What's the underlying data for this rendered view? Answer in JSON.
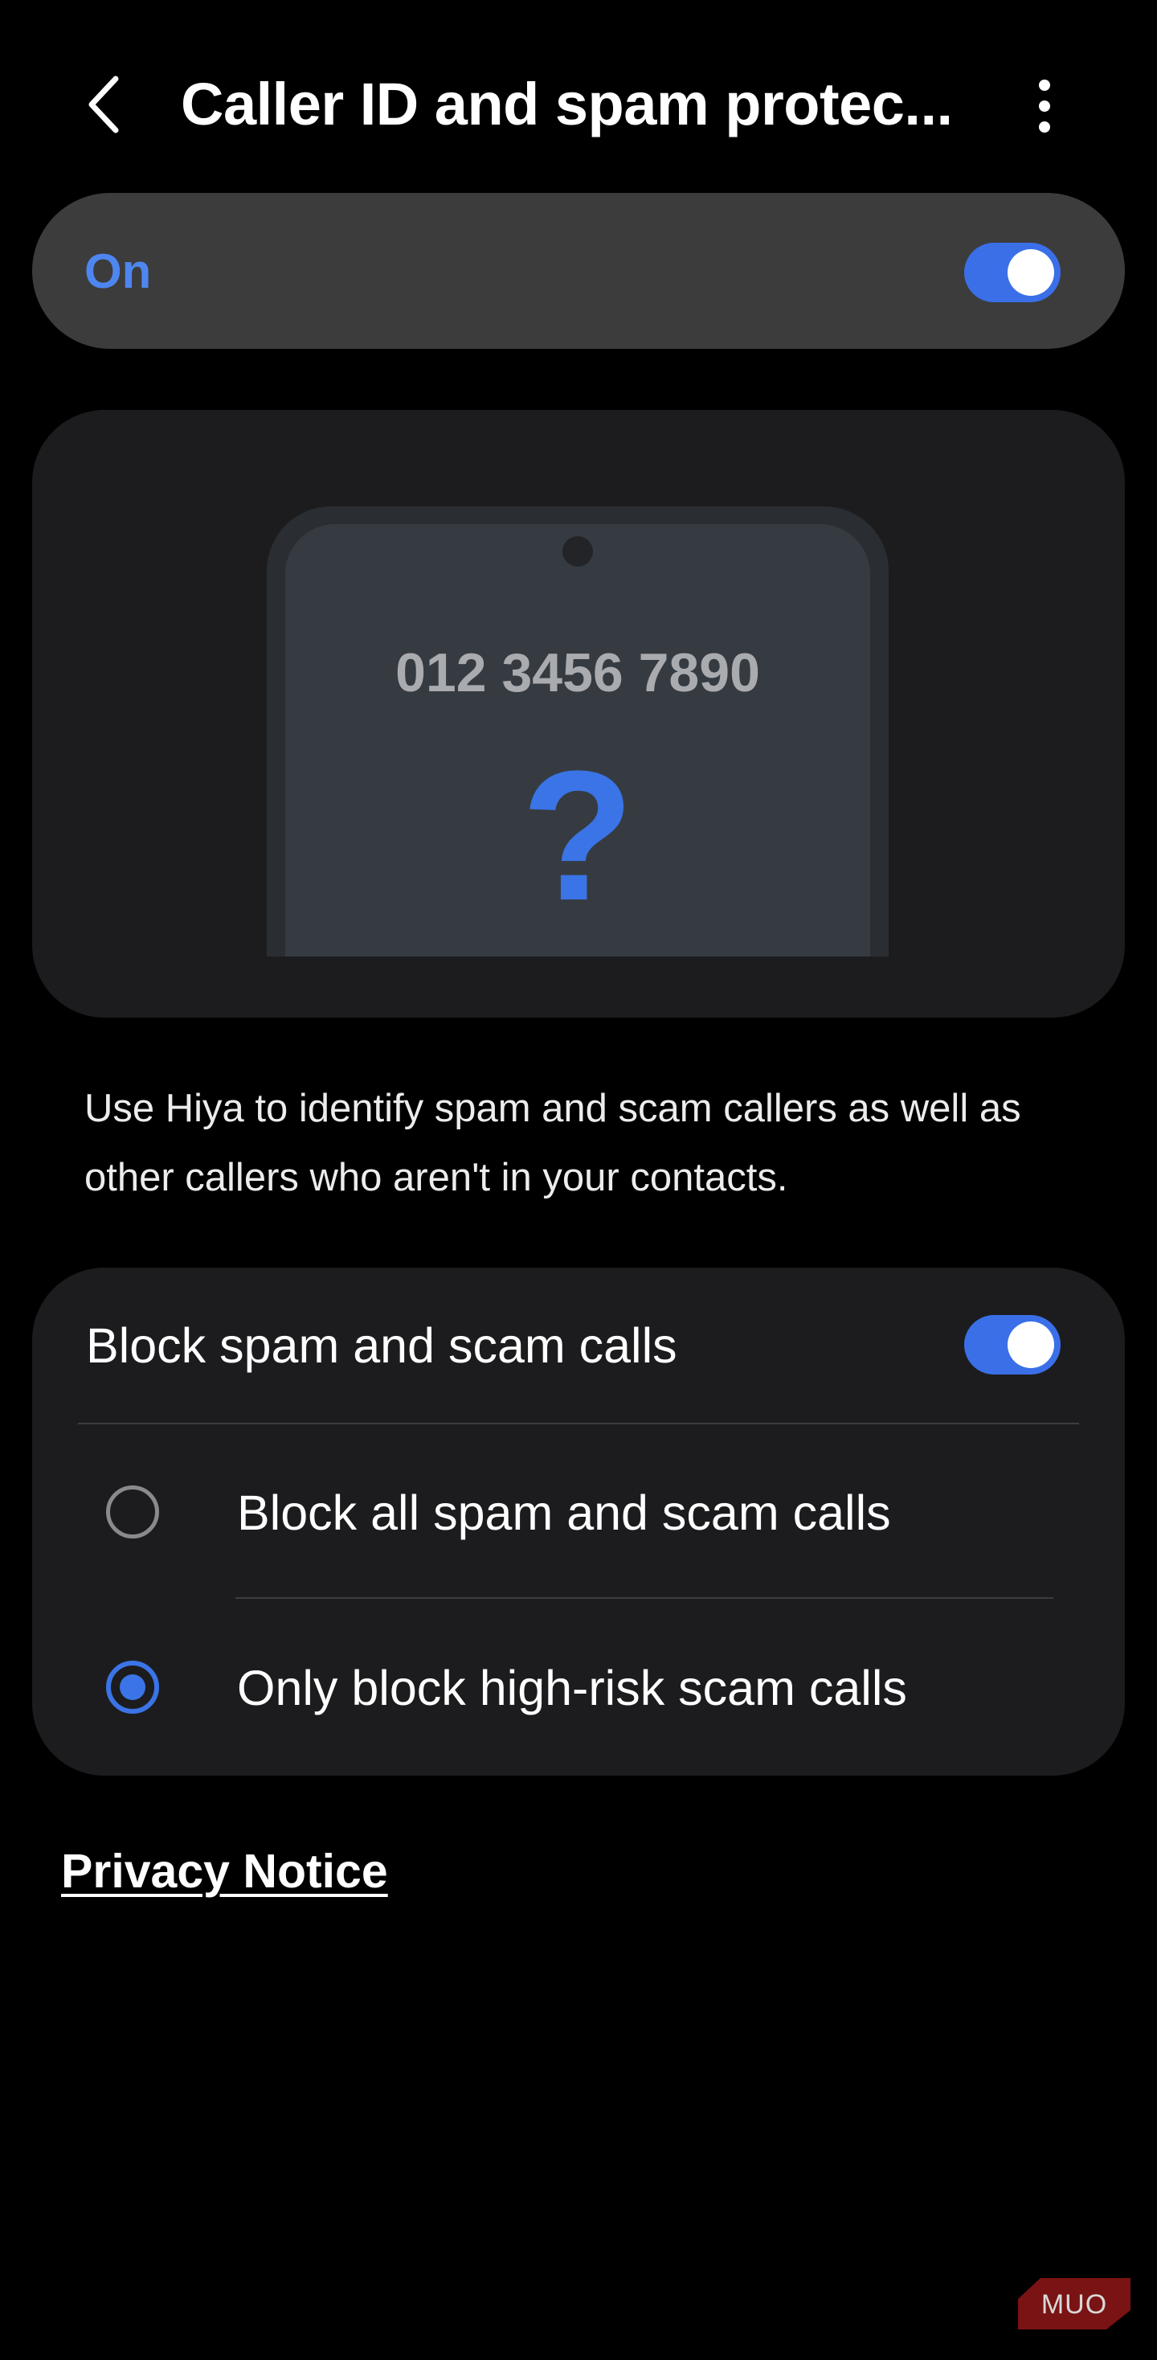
{
  "header": {
    "title": "Caller ID and spam protec...",
    "back_icon": "back-chevron-icon",
    "more_icon": "more-vertical-icon"
  },
  "master_switch": {
    "label": "On",
    "state": true
  },
  "illustration": {
    "phone_number": "012 3456 7890",
    "symbol": "?"
  },
  "description": "Use Hiya to identify spam and scam callers as well as other callers who aren't in your contacts.",
  "block_section": {
    "title": "Block spam and scam calls",
    "enabled": true,
    "options": [
      {
        "label": "Block all spam and scam calls",
        "selected": false
      },
      {
        "label": "Only block high-risk scam calls",
        "selected": true
      }
    ]
  },
  "privacy_link": "Privacy Notice",
  "watermark": "MUO",
  "colors": {
    "accent": "#3a74e6",
    "accent_text": "#4e86f0",
    "background": "#000000",
    "card": "#1c1c1e",
    "master_card": "#3c3c3c"
  }
}
